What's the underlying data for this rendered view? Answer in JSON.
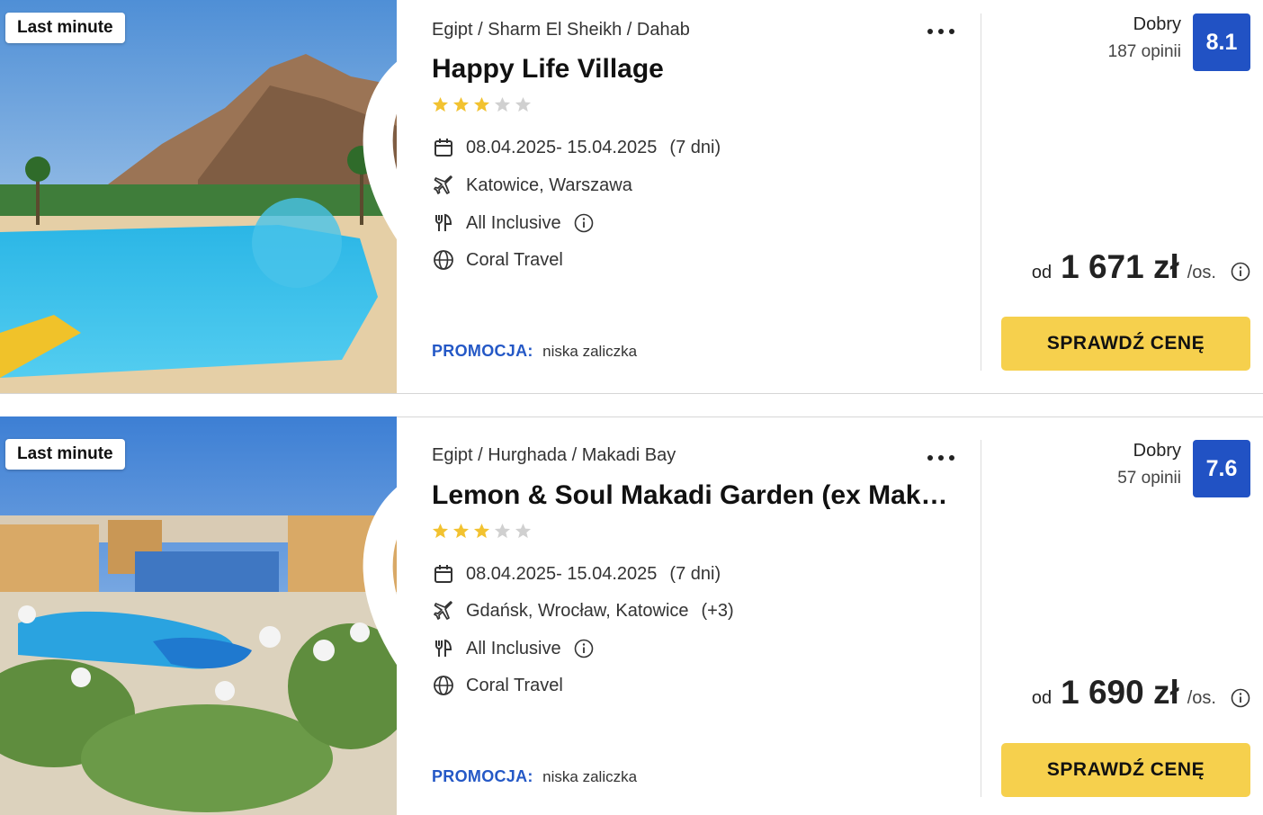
{
  "offers": [
    {
      "badge": "Last minute",
      "location": "Egipt / Sharm El Sheikh / Dahab",
      "name": "Happy Life Village",
      "stars": 3,
      "dates": "08.04.2025- 15.04.2025",
      "duration": "(7 dni)",
      "departures": "Katowice, Warszawa",
      "departures_extra": "",
      "board": "All Inclusive",
      "operator": "Coral Travel",
      "promo_label": "PROMOCJA:",
      "promo_value": "niska zaliczka",
      "rating_word": "Dobry",
      "rating_count": "187 opinii",
      "score": "8.1",
      "price_prefix": "od",
      "price": "1 671 zł",
      "price_suffix": "/os.",
      "cta": "SPRAWDŹ CENĘ"
    },
    {
      "badge": "Last minute",
      "location": "Egipt / Hurghada / Makadi Bay",
      "name": "Lemon & Soul Makadi Garden (ex Makadi Garden Azur)",
      "stars": 3,
      "dates": "08.04.2025- 15.04.2025",
      "duration": "(7 dni)",
      "departures": "Gdańsk, Wrocław, Katowice",
      "departures_extra": "(+3)",
      "board": "All Inclusive",
      "operator": "Coral Travel",
      "promo_label": "PROMOCJA:",
      "promo_value": "niska zaliczka",
      "rating_word": "Dobry",
      "rating_count": "57 opinii",
      "score": "7.6",
      "price_prefix": "od",
      "price": "1 690 zł",
      "price_suffix": "/os.",
      "cta": "SPRAWDŹ CENĘ"
    }
  ],
  "icons": {
    "favorite": "heart-icon",
    "more": "more-options-icon",
    "calendar": "calendar-icon",
    "flight": "plane-icon",
    "board": "cutlery-icon",
    "operator": "globe-icon",
    "info": "info-icon",
    "star": "star-icon"
  },
  "colors": {
    "score_bg": "#2152c4",
    "cta_bg": "#f6d04d",
    "promo_label": "#2458c6",
    "star_on": "#f2c230",
    "star_off": "#d0d0d0"
  }
}
